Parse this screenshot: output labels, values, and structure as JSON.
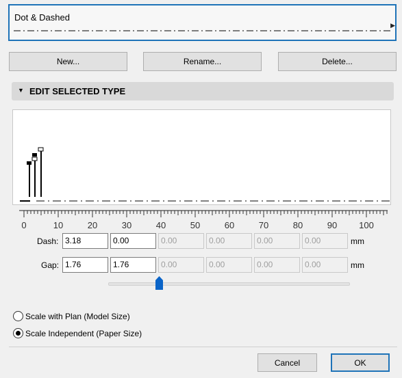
{
  "line_type": {
    "name": "Dot & Dashed",
    "arrow_glyph": "▶"
  },
  "buttons": {
    "new": "New...",
    "rename": "Rename...",
    "delete": "Delete..."
  },
  "section": {
    "caret_glyph": "▼",
    "title": "EDIT SELECTED TYPE"
  },
  "ruler": {
    "labels": [
      "0",
      "10",
      "20",
      "30",
      "40",
      "50",
      "60",
      "70",
      "80",
      "90",
      "100"
    ]
  },
  "dash": {
    "label": "Dash:",
    "values": [
      "3.18",
      "0.00",
      "0.00",
      "0.00",
      "0.00",
      "0.00"
    ],
    "unit": "mm"
  },
  "gap": {
    "label": "Gap:",
    "values": [
      "1.76",
      "1.76",
      "0.00",
      "0.00",
      "0.00",
      "0.00"
    ],
    "unit": "mm"
  },
  "scale_options": [
    {
      "label": "Scale with Plan (Model Size)",
      "checked": false
    },
    {
      "label": "Scale Independent (Paper Size)",
      "checked": true
    }
  ],
  "footer": {
    "cancel": "Cancel",
    "ok": "OK"
  },
  "colors": {
    "accent": "#1e73b8",
    "slider_thumb": "#0a64c8"
  }
}
